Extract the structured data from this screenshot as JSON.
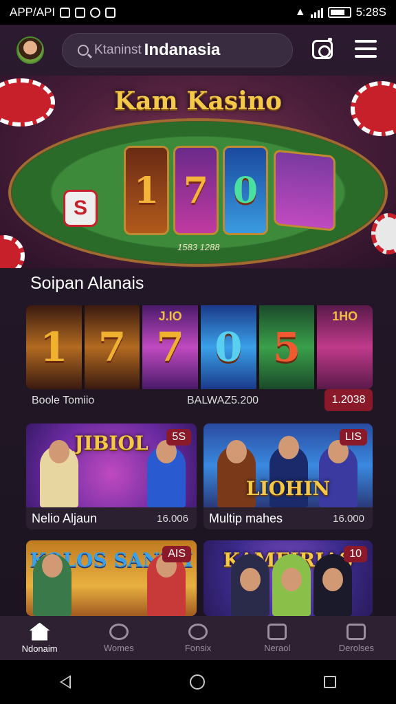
{
  "status_bar": {
    "left_text": "APP/API",
    "time": "5:28S"
  },
  "header": {
    "search_placeholder": "Ktaninst",
    "search_value": "Indanasia"
  },
  "hero": {
    "title": "Kam Kasino",
    "reels": [
      "1",
      "7",
      "0"
    ],
    "dice_label": "S",
    "code": "1583 1288"
  },
  "section": {
    "title": "Soipan Alanais"
  },
  "featured": {
    "slots": [
      {
        "symbol": "1",
        "tag": ""
      },
      {
        "symbol": "7",
        "tag": ""
      },
      {
        "symbol": "7",
        "tag": "J.IO"
      },
      {
        "symbol": "0",
        "tag": ""
      },
      {
        "symbol": "5",
        "tag": ""
      },
      {
        "symbol": "",
        "tag": "1HO"
      }
    ],
    "name": "Boole Tomiio",
    "amount": "BALWAZ5.200",
    "badge": "1.2038"
  },
  "cards": [
    {
      "title": "Nelio Aljaun",
      "value": "16.006",
      "badge": "5S",
      "logo": "JIBIOL"
    },
    {
      "title": "Multip mahes",
      "value": "16.000",
      "badge": "LIS",
      "logo": "LIOHIN"
    },
    {
      "title": "",
      "value": "",
      "badge": "AIS",
      "logo": "KOLOS SANEH"
    },
    {
      "title": "",
      "value": "",
      "badge": "10",
      "logo": "KAMEIRIAS"
    }
  ],
  "bottom_nav": [
    {
      "label": "Ndonaim",
      "icon": "home-icon",
      "active": true
    },
    {
      "label": "Womes",
      "icon": "users-icon",
      "active": false
    },
    {
      "label": "Fonsix",
      "icon": "clock-icon",
      "active": false
    },
    {
      "label": "Neraol",
      "icon": "book-icon",
      "active": false
    },
    {
      "label": "Derolses",
      "icon": "profile-icon",
      "active": false
    }
  ],
  "colors": {
    "background": "#221726",
    "accent_gold": "#f4c84a",
    "badge_red": "#8a1a2a"
  }
}
